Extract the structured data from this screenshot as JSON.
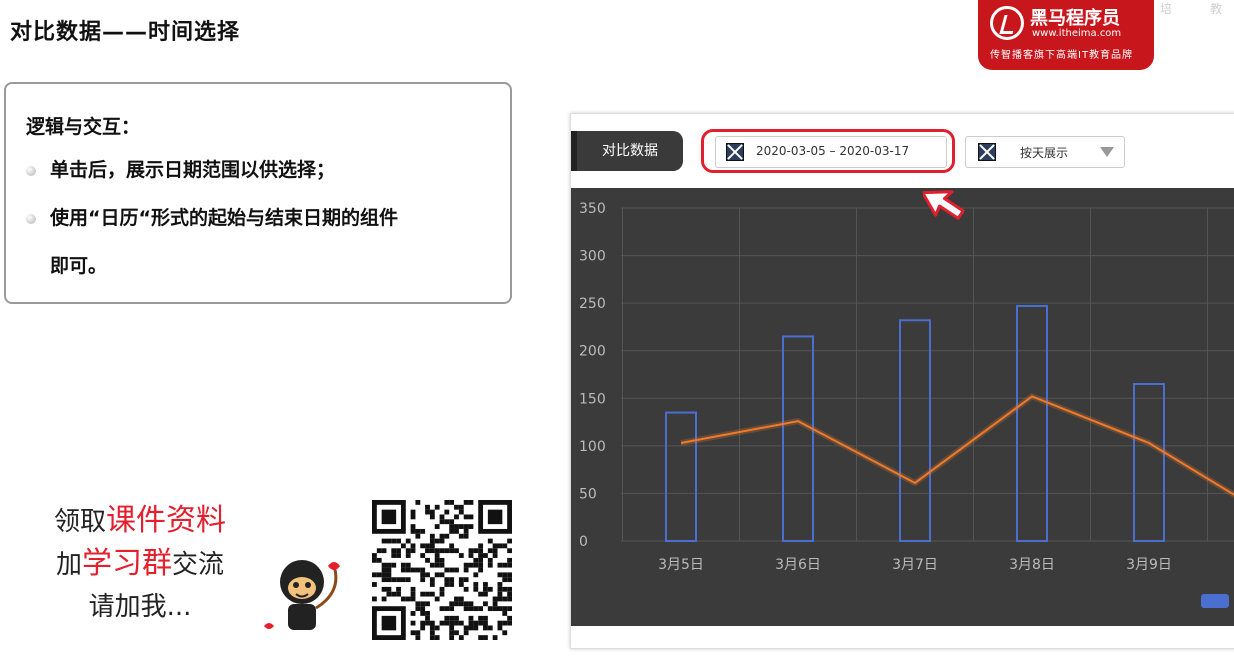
{
  "slide": {
    "title": "对比数据——时间选择"
  },
  "logo": {
    "brand": "黑马程序员",
    "url": "www.itheima.com",
    "slogan": "传智播客旗下高端IT教育品牌"
  },
  "note": {
    "heading": "逻辑与交互：",
    "bullets": [
      "单击后，展示日期范围以供选择；",
      "使用“日历“形式的起始与结束日期的组件",
      "即可。"
    ]
  },
  "promo": {
    "line1_a": "领取",
    "line1_b": "课件资料",
    "line2_a": "加",
    "line2_b": "学习群",
    "line2_c": "交流",
    "line3": "请加我..."
  },
  "chart_panel": {
    "compare_label": "对比数据",
    "date_range": "2020-03-05 – 2020-03-17",
    "display_mode": "按天展示",
    "colors": {
      "bar": "#4a6fd1",
      "line": "#f07a2a",
      "bg": "#3b3b3b",
      "highlight": "#e0202e"
    }
  },
  "chart_data": {
    "type": "bar",
    "categories": [
      "3月5日",
      "3月6日",
      "3月7日",
      "3月8日",
      "3月9日"
    ],
    "series": [
      {
        "kind": "bar",
        "values": [
          135,
          215,
          232,
          247,
          165
        ]
      },
      {
        "kind": "line",
        "values": [
          103,
          126,
          61,
          152,
          103
        ]
      }
    ],
    "ylim": [
      0,
      350
    ],
    "yticks": [
      0,
      50,
      100,
      150,
      200,
      250,
      300,
      350
    ],
    "grid": true
  }
}
